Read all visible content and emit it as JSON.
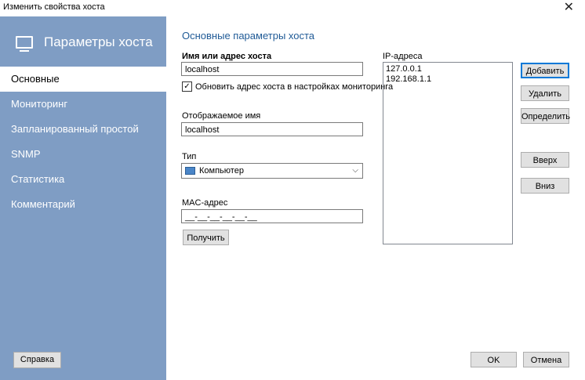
{
  "window": {
    "title": "Изменить свойства хоста",
    "close_glyph": "✕"
  },
  "sidebar": {
    "header": "Параметры хоста",
    "items": [
      {
        "label": "Основные",
        "active": true
      },
      {
        "label": "Мониторинг",
        "active": false
      },
      {
        "label": "Запланированный простой",
        "active": false
      },
      {
        "label": "SNMP",
        "active": false
      },
      {
        "label": "Статистика",
        "active": false
      },
      {
        "label": "Комментарий",
        "active": false
      }
    ],
    "help_label": "Справка"
  },
  "main": {
    "section_title": "Основные параметры хоста",
    "host_label": "Имя или адрес хоста",
    "host_value": "localhost",
    "update_checkbox_label": "Обновить адрес хоста в настройках мониторинга",
    "update_checked": true,
    "display_label": "Отображаемое имя",
    "display_value": "localhost",
    "type_label": "Тип",
    "type_value": "Компьютер",
    "mac_label": "MAC-адрес",
    "mac_value": "__-__-__-__-__-__",
    "get_button": "Получить",
    "ip_label": "IP-адреса",
    "ip_addresses": [
      "127.0.0.1",
      "192.168.1.1"
    ],
    "add_button": "Добавить",
    "delete_button": "Удалить",
    "detect_button": "Определить",
    "up_button": "Вверх",
    "down_button": "Вниз",
    "ok_button": "OK",
    "cancel_button": "Отмена"
  },
  "colors": {
    "sidebar": "#7f9dc4",
    "section_title": "#1f5a96",
    "accent": "#0078d7"
  }
}
